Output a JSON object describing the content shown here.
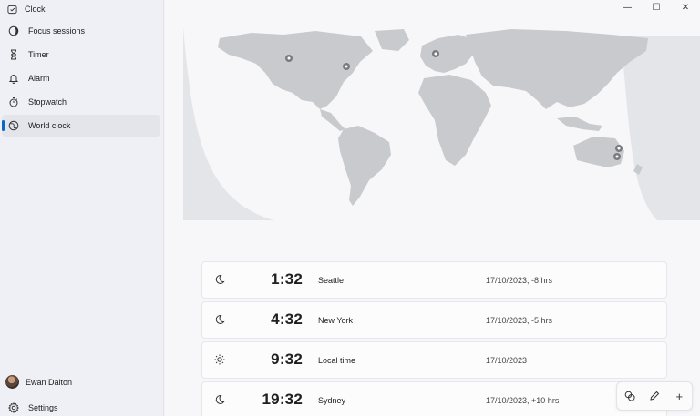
{
  "app": {
    "title": "Clock"
  },
  "sidebar": {
    "items": [
      {
        "label": "Focus sessions",
        "icon": "focus-icon"
      },
      {
        "label": "Timer",
        "icon": "hourglass-icon"
      },
      {
        "label": "Alarm",
        "icon": "bell-icon"
      },
      {
        "label": "Stopwatch",
        "icon": "stopwatch-icon"
      },
      {
        "label": "World clock",
        "icon": "globe-icon",
        "active": true
      }
    ],
    "profile_name": "Ewan Dalton",
    "settings_label": "Settings"
  },
  "window": {
    "minimize": "—",
    "maximize": "☐",
    "close": "✕"
  },
  "clocks": [
    {
      "time": "1:32",
      "city": "Seattle",
      "date": "17/10/2023, -8 hrs",
      "icon": "moon-icon"
    },
    {
      "time": "4:32",
      "city": "New York",
      "date": "17/10/2023, -5 hrs",
      "icon": "moon-icon"
    },
    {
      "time": "9:32",
      "city": "Local time",
      "date": "17/10/2023",
      "icon": "sun-icon"
    },
    {
      "time": "19:32",
      "city": "Sydney",
      "date": "17/10/2023, +10 hrs",
      "icon": "moon-icon"
    }
  ],
  "fab": {
    "compare": "compare-icon",
    "edit": "pencil-icon",
    "add": "+"
  },
  "colors": {
    "accent": "#0a66c8",
    "map_land": "#c9cacd",
    "map_night": "#e1e2e6"
  }
}
